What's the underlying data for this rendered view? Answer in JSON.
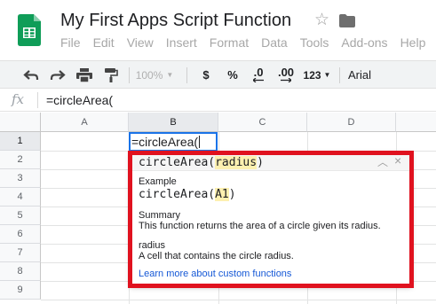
{
  "doc": {
    "title": "My First Apps Script Function",
    "menu": [
      "File",
      "Edit",
      "View",
      "Insert",
      "Format",
      "Data",
      "Tools",
      "Add-ons",
      "Help"
    ]
  },
  "toolbar": {
    "zoom": "100%",
    "currency": "$",
    "percent": "%",
    "decrease_decimals": ".0",
    "increase_decimals": ".00",
    "number_format": "123",
    "font": "Arial"
  },
  "formula_bar": {
    "fx_label": "fx",
    "value": "=circleArea("
  },
  "grid": {
    "columns": [
      "A",
      "B",
      "C",
      "D"
    ],
    "rows": [
      "1",
      "2",
      "3",
      "4",
      "5",
      "6",
      "7",
      "8",
      "9"
    ],
    "active_cell_value": "=circleArea("
  },
  "popup": {
    "signature_name": "circleArea(",
    "signature_param": "radius",
    "signature_close": ")",
    "example_label": "Example",
    "example_name": "circleArea(",
    "example_arg": "A1",
    "example_close": ")",
    "summary_label": "Summary",
    "summary_text": "This function returns the area of a circle given its radius.",
    "param_label": "radius",
    "param_text": "A cell that contains the circle radius.",
    "learn_more": "Learn more about custom functions"
  },
  "colors": {
    "highlight_border": "#e0121f",
    "active_cell": "#1a73e8",
    "sheets_green": "#0f9d58"
  }
}
